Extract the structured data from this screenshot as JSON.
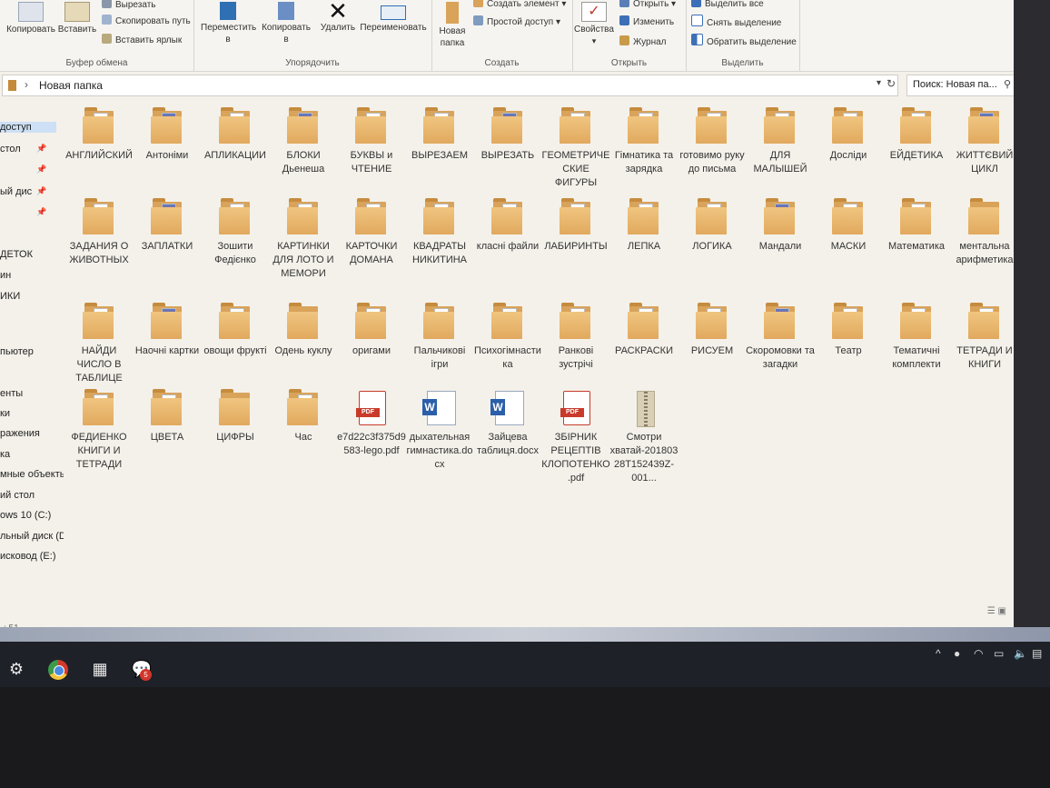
{
  "ribbon": {
    "clipboard": {
      "label": "Буфер обмена",
      "copy": "Копировать",
      "paste": "Вставить",
      "cut": "Вырезать",
      "copy_path": "Скопировать путь",
      "paste_shortcut": "Вставить ярлык"
    },
    "organize": {
      "label": "Упорядочить",
      "move_to": "Переместить в",
      "copy_to": "Копировать в",
      "delete": "Удалить",
      "rename": "Переименовать"
    },
    "create": {
      "label": "Создать",
      "new_folder": "Новая папка",
      "new_item": "Создать элемент",
      "easy_access": "Простой доступ"
    },
    "open": {
      "label": "Открыть",
      "properties": "Свойства",
      "open": "Открыть",
      "edit": "Изменить",
      "history": "Журнал"
    },
    "select": {
      "label": "Выделить",
      "select_all": "Выделить все",
      "select_none": "Снять выделение",
      "invert": "Обратить выделение"
    }
  },
  "address": {
    "path": "Новая папка",
    "search_placeholder": "Поиск: Новая па..."
  },
  "nav": {
    "items": [
      "доступ",
      "стол",
      "ый дис",
      "ДЕТОК",
      "ин",
      "ИКИ",
      "пьютер",
      "енты",
      "ки",
      "ражения",
      "ка",
      "мные объекты",
      "ий стол",
      "ows 10 (C:)",
      "льный диск (D",
      "исковод (E:)"
    ],
    "status": ": 51"
  },
  "files": [
    {
      "name": "АНГЛИЙСКИЙ",
      "type": "folder",
      "doc": "plain"
    },
    {
      "name": "Антоніми",
      "type": "folder",
      "doc": "pic"
    },
    {
      "name": "АПЛИКАЦИИ",
      "type": "folder",
      "doc": "plain"
    },
    {
      "name": "БЛОКИ Дьенеша",
      "type": "folder",
      "doc": "pic"
    },
    {
      "name": "БУКВЫ и ЧТЕНИЕ",
      "type": "folder",
      "doc": "mini"
    },
    {
      "name": "ВЫРЕЗАЕМ",
      "type": "folder",
      "doc": "plain"
    },
    {
      "name": "ВЫРЕЗАТЬ",
      "type": "folder",
      "doc": "pic"
    },
    {
      "name": "ГЕОМЕТРИЧЕСКИЕ ФИГУРЫ",
      "type": "folder",
      "doc": "plain"
    },
    {
      "name": "Гімнатика та зарядка",
      "type": "folder",
      "doc": "mini"
    },
    {
      "name": "готовимо руку до письма",
      "type": "folder",
      "doc": "plain"
    },
    {
      "name": "ДЛЯ МАЛЫШЕЙ",
      "type": "folder",
      "doc": "plain"
    },
    {
      "name": "Досліди",
      "type": "folder",
      "doc": "mini"
    },
    {
      "name": "ЕЙДЕТИКА",
      "type": "folder",
      "doc": "plain"
    },
    {
      "name": "ЖИТТЄВИЙ ЦИКЛ",
      "type": "folder",
      "doc": "pic"
    },
    {
      "name": "ЗАДАНИЯ О ЖИВОТНЫХ",
      "type": "folder",
      "doc": "plain"
    },
    {
      "name": "ЗАПЛАТКИ",
      "type": "folder",
      "doc": "pic"
    },
    {
      "name": "Зошити Федієнко",
      "type": "folder",
      "doc": "plain"
    },
    {
      "name": "КАРТИНКИ ДЛЯ ЛОТО И МЕМОРИ",
      "type": "folder",
      "doc": "mini"
    },
    {
      "name": "КАРТОЧКИ ДОМАНА",
      "type": "folder",
      "doc": "plain"
    },
    {
      "name": "КВАДРАТЫ НИКИТИНА",
      "type": "folder",
      "doc": "plain"
    },
    {
      "name": "класні файли",
      "type": "folder",
      "doc": "plain"
    },
    {
      "name": "ЛАБИРИНТЫ",
      "type": "folder",
      "doc": "mini"
    },
    {
      "name": "ЛЕПКА",
      "type": "folder",
      "doc": "plain"
    },
    {
      "name": "ЛОГИКА",
      "type": "folder",
      "doc": "plain"
    },
    {
      "name": "Мандали",
      "type": "folder",
      "doc": "pic"
    },
    {
      "name": "МАСКИ",
      "type": "folder",
      "doc": "plain"
    },
    {
      "name": "Математика",
      "type": "folder",
      "doc": "plain"
    },
    {
      "name": "ментальна арифметика",
      "type": "folder",
      "doc": "none"
    },
    {
      "name": "НАЙДИ ЧИСЛО В ТАБЛИЦЕ",
      "type": "folder",
      "doc": "plain"
    },
    {
      "name": "Наочні картки",
      "type": "folder",
      "doc": "pic"
    },
    {
      "name": "овощи фрукті",
      "type": "folder",
      "doc": "plain"
    },
    {
      "name": "Одень куклу",
      "type": "folder",
      "doc": "none"
    },
    {
      "name": "оригами",
      "type": "folder",
      "doc": "plain"
    },
    {
      "name": "Пальчикові ігри",
      "type": "folder",
      "doc": "plain"
    },
    {
      "name": "Психогімнастика",
      "type": "folder",
      "doc": "mini"
    },
    {
      "name": "Ранкові зустрічі",
      "type": "folder",
      "doc": "mini"
    },
    {
      "name": "РАСКРАСКИ",
      "type": "folder",
      "doc": "mini"
    },
    {
      "name": "РИСУЕМ",
      "type": "folder",
      "doc": "plain"
    },
    {
      "name": "Скоромовки та загадки",
      "type": "folder",
      "doc": "pic"
    },
    {
      "name": "Театр",
      "type": "folder",
      "doc": "mini"
    },
    {
      "name": "Тематичні комплекти",
      "type": "folder",
      "doc": "plain"
    },
    {
      "name": "ТЕТРАДИ И КНИГИ",
      "type": "folder",
      "doc": "plain"
    },
    {
      "name": "ФЕДИЕНКО КНИГИ И ТЕТРАДИ",
      "type": "folder",
      "doc": "plain"
    },
    {
      "name": "ЦВЕТА",
      "type": "folder",
      "doc": "plain"
    },
    {
      "name": "ЦИФРЫ",
      "type": "folder",
      "doc": "none"
    },
    {
      "name": "Час",
      "type": "folder",
      "doc": "plain"
    },
    {
      "name": "e7d22c3f375d9583-lego.pdf",
      "type": "pdf"
    },
    {
      "name": "дыхательная гимнастика.docx",
      "type": "word"
    },
    {
      "name": "Зайцева таблиця.docx",
      "type": "word"
    },
    {
      "name": "ЗБІРНИК РЕЦЕПТІВ КЛОПОТЕНКО .pdf",
      "type": "pdf"
    },
    {
      "name": "Смотри хватай-20180328T152439Z-001...",
      "type": "zip"
    }
  ],
  "taskbar": {
    "badge": "5"
  },
  "colors": {
    "folder": "#e1a95e",
    "pdf": "#c83a2a",
    "word": "#2b5faa",
    "selection": "#cde0f5"
  }
}
